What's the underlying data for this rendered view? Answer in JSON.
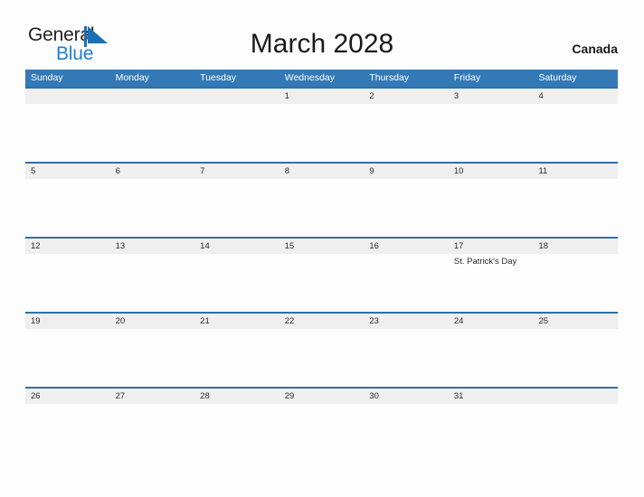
{
  "brand": {
    "name_part1": "General",
    "name_part2": "Blue",
    "mark_icon": "blue-flag-triangle-icon",
    "color_primary": "#1c7fd4",
    "color_dark": "#231f20"
  },
  "header": {
    "title": "March 2028",
    "region": "Canada"
  },
  "theme": {
    "header_blue": "#3479b5",
    "row_border_blue": "#2f6fa8",
    "date_strip_gray": "#efefef",
    "page_bg": "#fdfdfd",
    "text_dark": "#2a2a2a"
  },
  "calendar": {
    "weekdays": [
      "Sunday",
      "Monday",
      "Tuesday",
      "Wednesday",
      "Thursday",
      "Friday",
      "Saturday"
    ],
    "weeks": [
      {
        "days": [
          {
            "date": "",
            "event": ""
          },
          {
            "date": "",
            "event": ""
          },
          {
            "date": "",
            "event": ""
          },
          {
            "date": "1",
            "event": ""
          },
          {
            "date": "2",
            "event": ""
          },
          {
            "date": "3",
            "event": ""
          },
          {
            "date": "4",
            "event": ""
          }
        ]
      },
      {
        "days": [
          {
            "date": "5",
            "event": ""
          },
          {
            "date": "6",
            "event": ""
          },
          {
            "date": "7",
            "event": ""
          },
          {
            "date": "8",
            "event": ""
          },
          {
            "date": "9",
            "event": ""
          },
          {
            "date": "10",
            "event": ""
          },
          {
            "date": "11",
            "event": ""
          }
        ]
      },
      {
        "days": [
          {
            "date": "12",
            "event": ""
          },
          {
            "date": "13",
            "event": ""
          },
          {
            "date": "14",
            "event": ""
          },
          {
            "date": "15",
            "event": ""
          },
          {
            "date": "16",
            "event": ""
          },
          {
            "date": "17",
            "event": "St. Patrick's Day"
          },
          {
            "date": "18",
            "event": ""
          }
        ]
      },
      {
        "days": [
          {
            "date": "19",
            "event": ""
          },
          {
            "date": "20",
            "event": ""
          },
          {
            "date": "21",
            "event": ""
          },
          {
            "date": "22",
            "event": ""
          },
          {
            "date": "23",
            "event": ""
          },
          {
            "date": "24",
            "event": ""
          },
          {
            "date": "25",
            "event": ""
          }
        ]
      },
      {
        "days": [
          {
            "date": "26",
            "event": ""
          },
          {
            "date": "27",
            "event": ""
          },
          {
            "date": "28",
            "event": ""
          },
          {
            "date": "29",
            "event": ""
          },
          {
            "date": "30",
            "event": ""
          },
          {
            "date": "31",
            "event": ""
          },
          {
            "date": "",
            "event": ""
          }
        ]
      }
    ]
  }
}
